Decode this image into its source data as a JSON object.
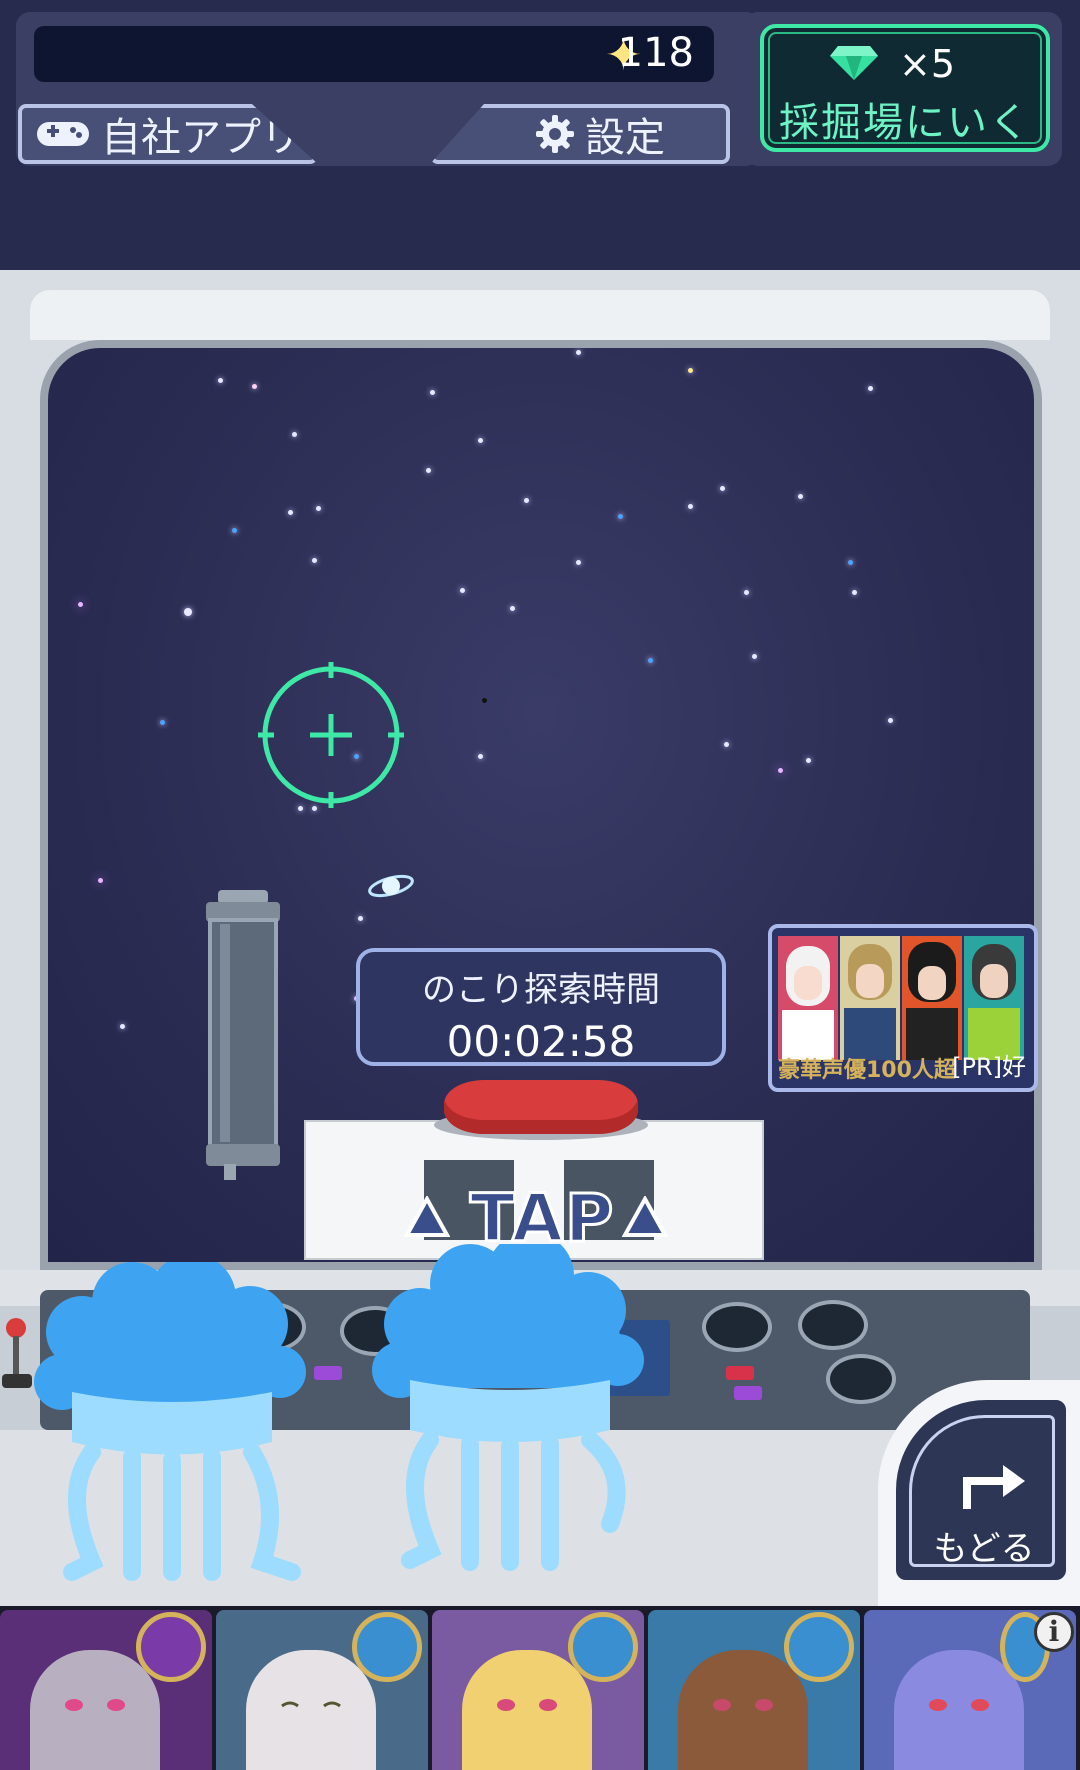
{
  "header": {
    "coin_star": "✦",
    "coin_value": "118",
    "apps_button_label": "自社アプリ",
    "settings_button_label": "設定",
    "mine_gem_count": "×5",
    "mine_button_label": "採掘場にいく"
  },
  "exploration": {
    "timer_label": "のこり探索時間",
    "timer_value": "00:02:58",
    "tap_label": "TAP"
  },
  "ad_banner": {
    "title_text": "豪華声優100人超",
    "tag": "[PR]好"
  },
  "back_button": {
    "label": "もどる"
  },
  "deck": {
    "cards": [
      {
        "element": "dark-moon-icon",
        "color": "#7a3aa8"
      },
      {
        "element": "water-drop-icon",
        "color": "#3a8fd0"
      },
      {
        "element": "water-drop-icon",
        "color": "#3a8fd0"
      },
      {
        "element": "water-drop-icon",
        "color": "#3a8fd0"
      },
      {
        "element": "water-drop-icon",
        "color": "#3a8fd0"
      }
    ],
    "info_icon": "i"
  },
  "colors": {
    "accent_green": "#3ee8a6",
    "space_bg": "#2a2c52",
    "jelly_blue": "#8fd3ff"
  }
}
